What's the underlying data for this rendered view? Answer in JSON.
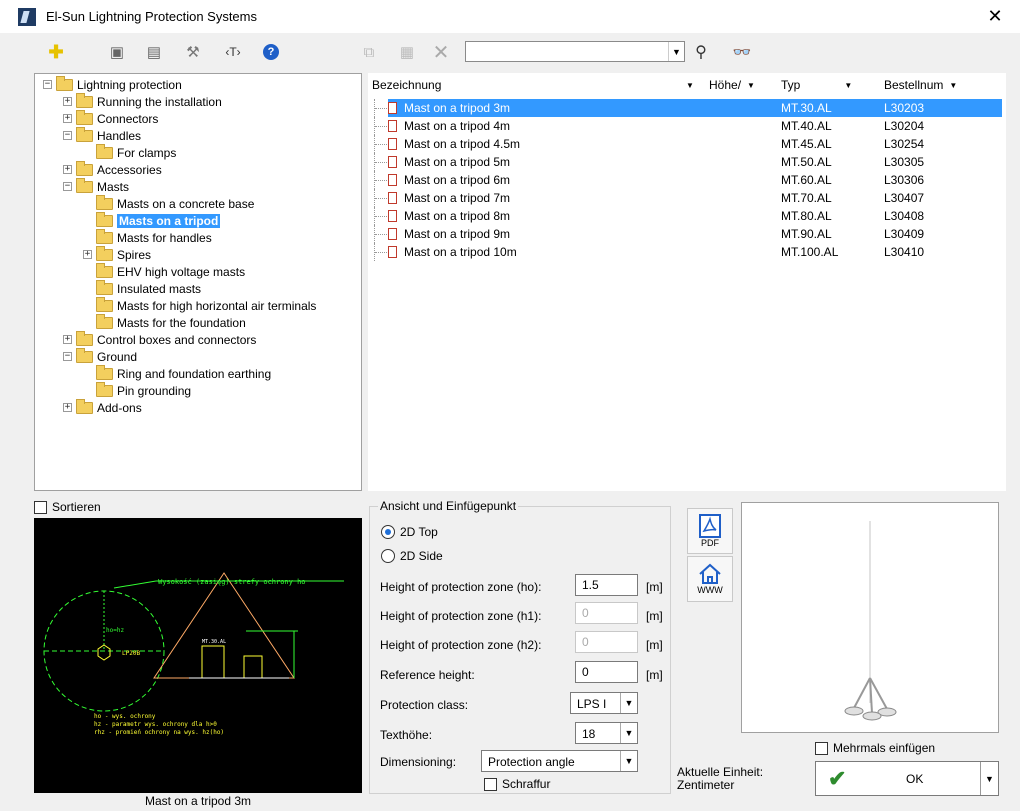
{
  "window": {
    "title": "El-Sun Lightning Protection Systems"
  },
  "toolbar": {
    "search_value": ""
  },
  "tree": [
    {
      "label": "Lightning protection",
      "depth": 0,
      "expander": "minus"
    },
    {
      "label": "Running the installation",
      "depth": 1,
      "expander": "plus"
    },
    {
      "label": "Connectors",
      "depth": 1,
      "expander": "plus"
    },
    {
      "label": "Handles",
      "depth": 1,
      "expander": "minus"
    },
    {
      "label": "For clamps",
      "depth": 2,
      "expander": "none"
    },
    {
      "label": "Accessories",
      "depth": 1,
      "expander": "plus"
    },
    {
      "label": "Masts",
      "depth": 1,
      "expander": "minus"
    },
    {
      "label": "Masts on a concrete base",
      "depth": 2,
      "expander": "none"
    },
    {
      "label": "Masts on a tripod",
      "depth": 2,
      "expander": "none",
      "selected": true
    },
    {
      "label": "Masts for handles",
      "depth": 2,
      "expander": "none"
    },
    {
      "label": "Spires",
      "depth": 2,
      "expander": "plus"
    },
    {
      "label": "EHV high voltage masts",
      "depth": 2,
      "expander": "none"
    },
    {
      "label": "Insulated masts",
      "depth": 2,
      "expander": "none"
    },
    {
      "label": "Masts for high horizontal air terminals",
      "depth": 2,
      "expander": "none"
    },
    {
      "label": "Masts for the foundation",
      "depth": 2,
      "expander": "none"
    },
    {
      "label": "Control boxes and connectors",
      "depth": 1,
      "expander": "plus"
    },
    {
      "label": "Ground",
      "depth": 1,
      "expander": "minus"
    },
    {
      "label": "Ring and foundation earthing",
      "depth": 2,
      "expander": "none"
    },
    {
      "label": "Pin grounding",
      "depth": 2,
      "expander": "none"
    },
    {
      "label": "Add-ons",
      "depth": 1,
      "expander": "plus"
    }
  ],
  "list": {
    "columns": [
      "Bezeichnung",
      "Höhe/",
      "Typ",
      "Bestellnum"
    ],
    "rows": [
      {
        "name": "Mast on a tripod 3m",
        "typ": "MT.30.AL",
        "nr": "L30203",
        "selected": true
      },
      {
        "name": "Mast on a tripod 4m",
        "typ": "MT.40.AL",
        "nr": "L30204"
      },
      {
        "name": "Mast on a tripod 4.5m",
        "typ": "MT.45.AL",
        "nr": "L30254"
      },
      {
        "name": "Mast on a tripod 5m",
        "typ": "MT.50.AL",
        "nr": "L30305"
      },
      {
        "name": "Mast on a tripod 6m",
        "typ": "MT.60.AL",
        "nr": "L30306"
      },
      {
        "name": "Mast on a tripod 7m",
        "typ": "MT.70.AL",
        "nr": "L30407"
      },
      {
        "name": "Mast on a tripod 8m",
        "typ": "MT.80.AL",
        "nr": "L30408"
      },
      {
        "name": "Mast on a tripod 9m",
        "typ": "MT.90.AL",
        "nr": "L30409"
      },
      {
        "name": "Mast on a tripod 10m",
        "typ": "MT.100.AL",
        "nr": "L30410"
      }
    ]
  },
  "sort_label": "Sortieren",
  "preview": {
    "caption": "Mast on a tripod 3m",
    "cad_title": "Wysokość (zasięg) strefy ochrony ho",
    "cad_ho_hz": "ho=hz",
    "cad_code": "LP20B",
    "cad_mt": "MT.30.AL",
    "cad_legend": [
      "ho  - wys. ochrony",
      "hz  - parametr wys. ochrony dla h>0",
      "rhz - promień ochrony na wys. hz(ho)"
    ]
  },
  "group": {
    "title": "Ansicht und Einfügepunkt",
    "radio_2d_top": "2D Top",
    "radio_2d_side": "2D Side"
  },
  "fields": [
    {
      "label": "Height of protection zone (ho):",
      "value": "1.5",
      "unit": "[m]",
      "enabled": true
    },
    {
      "label": "Height of protection zone (h1):",
      "value": "0",
      "unit": "[m]",
      "enabled": false
    },
    {
      "label": "Height of protection zone (h2):",
      "value": "0",
      "unit": "[m]",
      "enabled": false
    },
    {
      "label": "Reference height:",
      "value": "0",
      "unit": "[m]",
      "enabled": true
    }
  ],
  "protection_class": {
    "label": "Protection class:",
    "value": "LPS I"
  },
  "texthoehe": {
    "label": "Texthöhe:",
    "value": "18"
  },
  "dimensioning": {
    "label": "Dimensioning:",
    "value": "Protection angle"
  },
  "schraffur": "Schraffur",
  "buttons": {
    "pdf": "PDF",
    "www": "WWW",
    "ok": "OK"
  },
  "mehrmals": "Mehrmals einfügen",
  "unit_info": {
    "line1": "Aktuelle Einheit:",
    "line2": "Zentimeter"
  },
  "colors": {
    "selection": "#3399ff",
    "cad_green": "#33ff33",
    "cad_yellow": "#ffff33"
  }
}
